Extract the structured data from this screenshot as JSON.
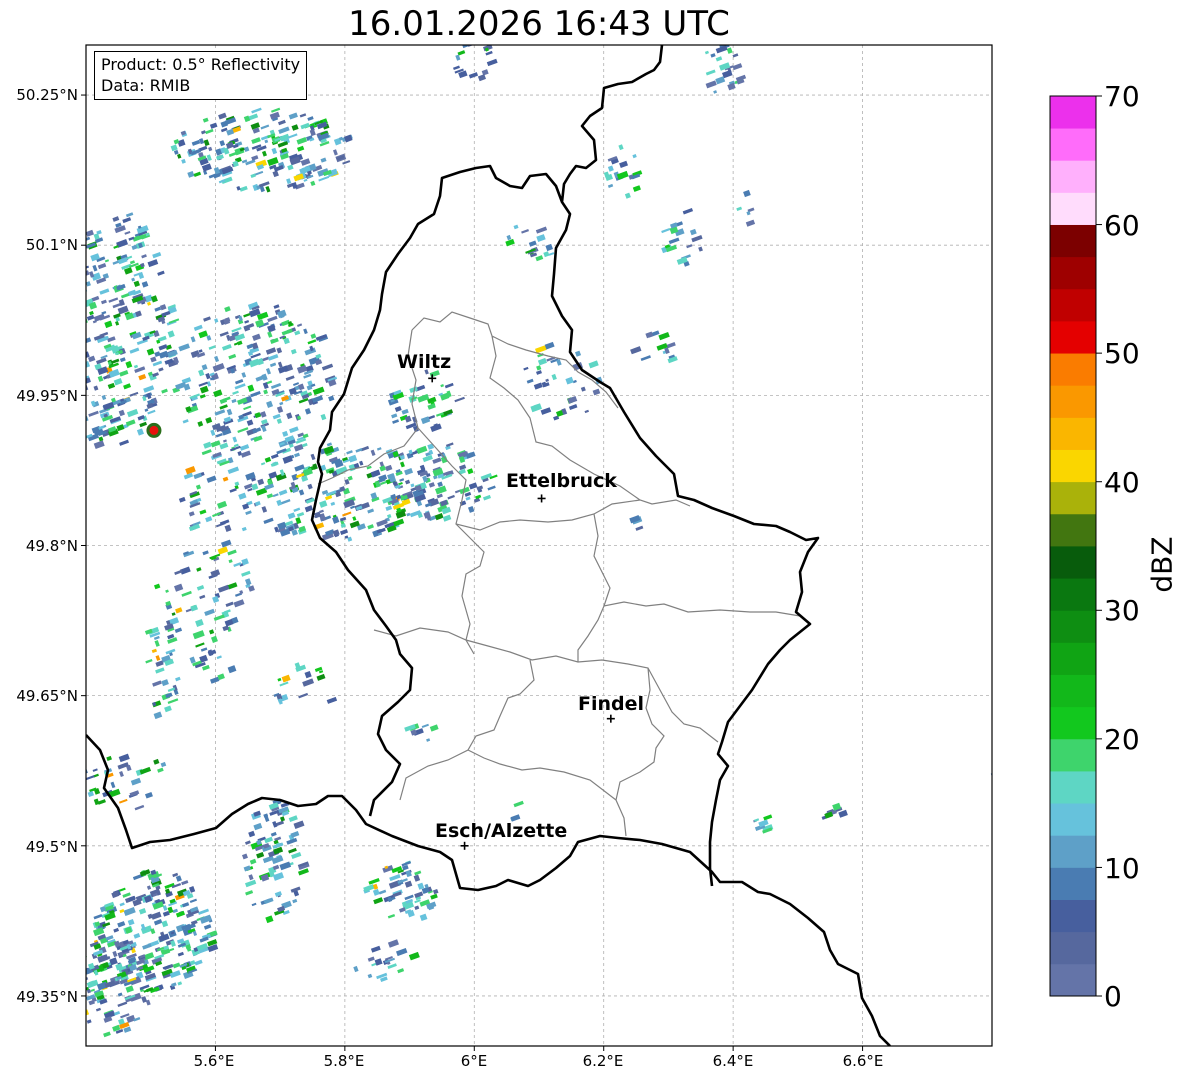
{
  "title": "16.01.2026 16:43 UTC",
  "info": {
    "product": "Product: 0.5° Reflectivity",
    "data": "Data: RMIB"
  },
  "lat_labels": [
    "50.25°N",
    "50.1°N",
    "49.95°N",
    "49.8°N",
    "49.65°N",
    "49.5°N",
    "49.35°N"
  ],
  "lon_labels": [
    "5.6°E",
    "5.8°E",
    "6°E",
    "6.2°E",
    "6.4°E",
    "6.6°E"
  ],
  "cities": [
    {
      "name": "Wiltz",
      "lon": 5.935,
      "lat": 49.967
    },
    {
      "name": "Ettelbruck",
      "lon": 6.104,
      "lat": 49.847
    },
    {
      "name": "Findel",
      "lon": 6.211,
      "lat": 49.627
    },
    {
      "name": "Esch/Alzette",
      "lon": 5.985,
      "lat": 49.5
    }
  ],
  "radar_site": {
    "lon": 5.505,
    "lat": 49.915,
    "color": "#e8120c"
  },
  "colorbar": {
    "label": "dBZ",
    "ticks": [
      "0",
      "10",
      "20",
      "30",
      "40",
      "50",
      "60",
      "70"
    ],
    "vmin": 0,
    "vmax": 70,
    "step": 2.5,
    "colors": [
      "#6474a8",
      "#56689e",
      "#475f9e",
      "#4a7cb2",
      "#5ea0c8",
      "#66c2dc",
      "#5ed6c4",
      "#3ed46c",
      "#12c81e",
      "#12b81a",
      "#10a414",
      "#0e8e12",
      "#0a7810",
      "#085c0c",
      "#427610",
      "#aab20a",
      "#fad600",
      "#fab600",
      "#fa9800",
      "#fa7c00",
      "#e40000",
      "#c00000",
      "#9e0000",
      "#7c0000",
      "#ffdcfc",
      "#ffb0fc",
      "#ff6cfa",
      "#ec30ec"
    ]
  },
  "map_extent": {
    "lon_min": 5.4,
    "lon_max": 6.8,
    "lat_min": 49.3,
    "lat_max": 50.3
  }
}
